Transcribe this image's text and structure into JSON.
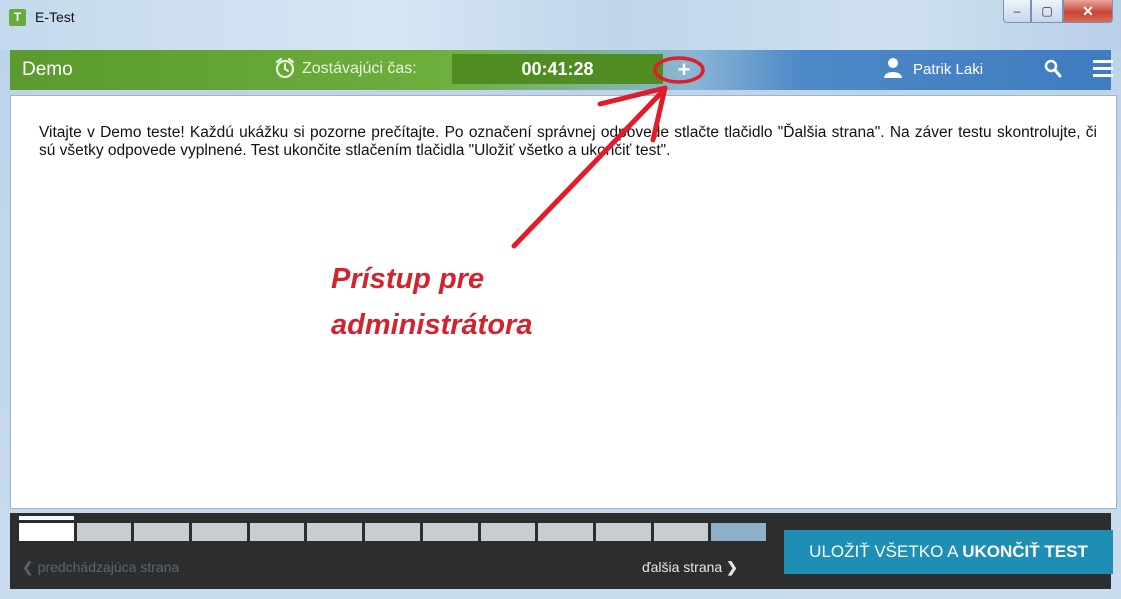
{
  "window": {
    "app_icon_letter": "T",
    "title": "E-Test",
    "controls": {
      "minimize": "–",
      "maximize": "▢",
      "close": "✕"
    }
  },
  "header": {
    "test_name": "Demo",
    "timer_label": "Zostávajúci čas:",
    "timer_value": "00:41:28",
    "admin_plus": "+",
    "user_name": "Patrik Laki",
    "icons": [
      "alarm-clock-icon",
      "user-icon",
      "search-icon",
      "menu-icon"
    ]
  },
  "content": {
    "intro_text": "Vitajte v Demo teste! Každú ukážku si pozorne prečítajte. Po označení správnej odpovede stlačte tlačidlo \"Ďalšia strana\". Na záver testu skontrolujte, či sú všetky odpovede vyplnené. Test ukončite stlačením tlačidla \"Uložiť všetko a ukončiť test\".",
    "annotation_line1": "Prístup pre",
    "annotation_line2": "administrátora"
  },
  "navigation": {
    "page_segments": 13,
    "current_segment": 1,
    "prev_label": "predchádzajúca strana",
    "next_label": "ďalšia strana",
    "finish_label_regular": "ULOŽIŤ VŠETKO A ",
    "finish_label_bold": "UKONČIŤ TEST"
  },
  "colors": {
    "accent_green": "#4f8d23",
    "accent_blue": "#1f8eb4",
    "annotation_red": "#d2242f"
  }
}
